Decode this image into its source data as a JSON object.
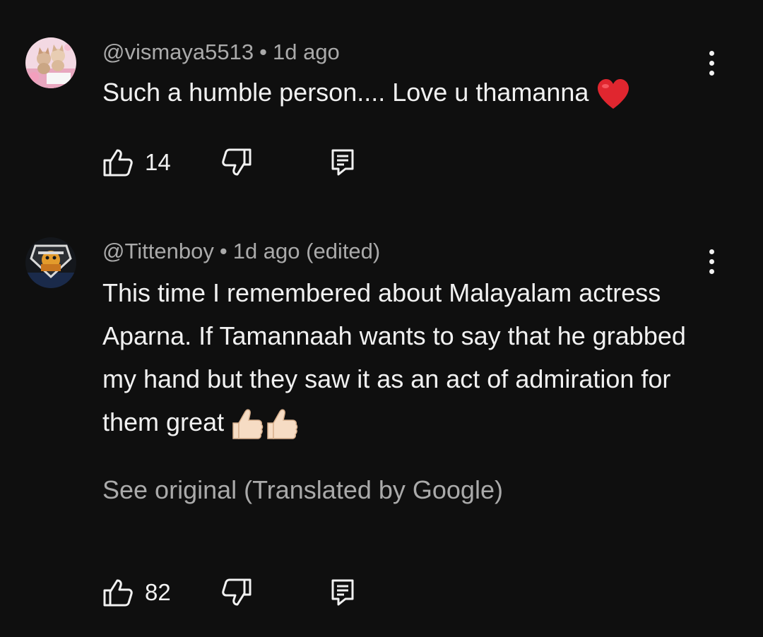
{
  "comments": [
    {
      "handle": "@vismaya5513",
      "separator": "•",
      "time": "1d ago",
      "text": "Such a humble person.... Love u thamanna",
      "emoji": "heart-emoji",
      "like_count": "14",
      "avatar": "puppies-avatar"
    },
    {
      "handle": "@Tittenboy",
      "separator": "•",
      "time": "1d ago (edited)",
      "text": "This time I remembered about Malayalam actress Aparna. If Tamannaah wants to say that he grabbed my hand but they saw it as an act of admiration for them great",
      "emoji": "thumbs-up-emoji",
      "see_original": "See original (Translated by Google)",
      "like_count": "82",
      "avatar": "gamer-logo-avatar"
    }
  ],
  "icons": {
    "like": "thumbs-up-icon",
    "dislike": "thumbs-down-icon",
    "reply": "reply-icon",
    "more": "more-vert-icon"
  },
  "colors": {
    "background": "#0f0f0f",
    "primary_text": "#f1f1f1",
    "secondary_text": "#aaaaaa",
    "heart": "#e0262f"
  }
}
